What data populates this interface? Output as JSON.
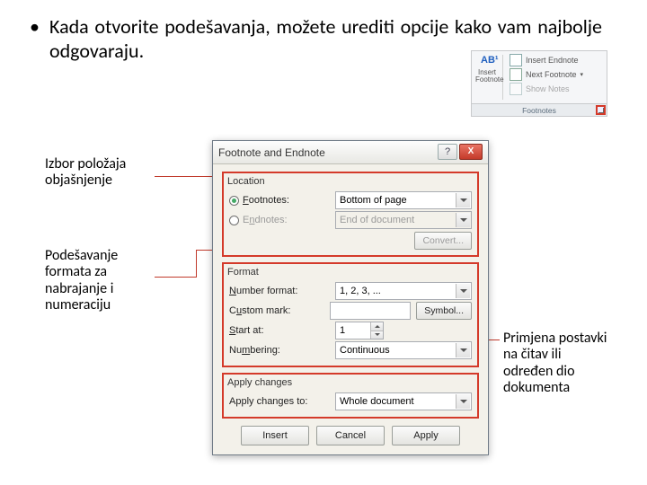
{
  "bullet": "Kada otvorite podešavanja, možete urediti opcije kako vam najbolje odgovaraju.",
  "callouts": {
    "c1": "Izbor položaja objašnjenje",
    "c2": "Podešavanje formata za nabrajanje i numeraciju",
    "c3": "Primjena postavki na čitav ili određen dio dokumenta"
  },
  "ribbon": {
    "ab": "AB¹",
    "insert_label": "Insert Footnote",
    "insert_endnote": "Insert Endnote",
    "next_footnote": "Next Footnote",
    "show_notes": "Show Notes",
    "group": "Footnotes"
  },
  "dialog": {
    "title": "Footnote and Endnote",
    "help": "?",
    "close": "X",
    "location": {
      "title": "Location",
      "footnotes_label": "Footnotes:",
      "footnotes_value": "Bottom of page",
      "endnotes_label": "Endnotes:",
      "endnotes_value": "End of document",
      "convert": "Convert..."
    },
    "format": {
      "title": "Format",
      "number_format_label": "Number format:",
      "number_format_value": "1, 2, 3, ...",
      "custom_mark_label": "Custom mark:",
      "symbol": "Symbol...",
      "start_at_label": "Start at:",
      "start_at_value": "1",
      "numbering_label": "Numbering:",
      "numbering_value": "Continuous"
    },
    "apply": {
      "title": "Apply changes",
      "to_label": "Apply changes to:",
      "to_value": "Whole document"
    },
    "buttons": {
      "insert": "Insert",
      "cancel": "Cancel",
      "apply": "Apply"
    }
  }
}
